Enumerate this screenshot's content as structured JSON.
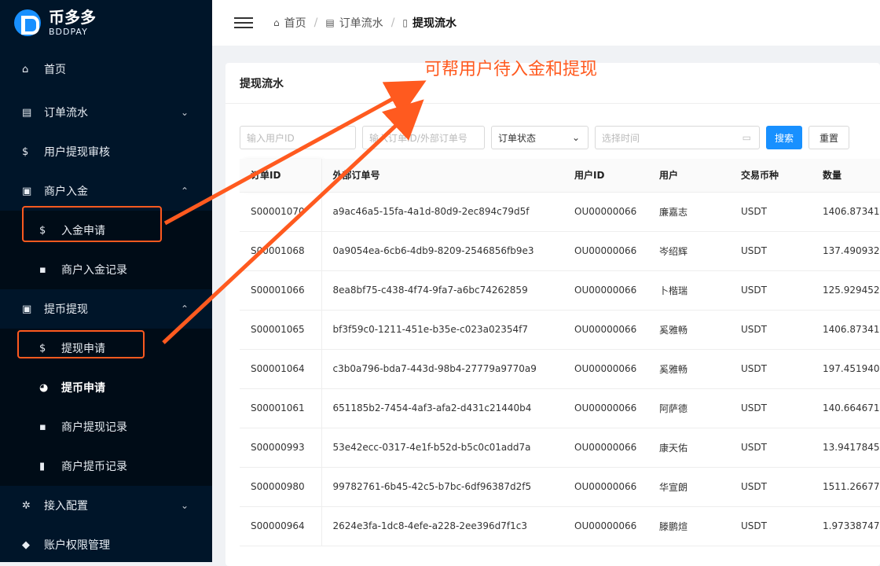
{
  "brand": {
    "name": "币多多",
    "sub": "BDDPAY"
  },
  "sidebar": {
    "items": [
      {
        "label": "首页",
        "icon": "home-icon",
        "glyph": "⌂"
      },
      {
        "label": "订单流水",
        "icon": "book-icon",
        "glyph": "▤",
        "arrow": "⌄"
      },
      {
        "label": "用户提现审核",
        "icon": "dollar-icon",
        "glyph": "$"
      },
      {
        "label": "商户入金",
        "icon": "money-icon",
        "glyph": "▣",
        "arrow": "⌃"
      }
    ],
    "deposit_sub": [
      {
        "label": "入金申请",
        "icon": "dollar-icon",
        "glyph": "$"
      },
      {
        "label": "商户入金记录",
        "icon": "doc-icon",
        "glyph": "▪"
      }
    ],
    "withdraw_group": {
      "label": "提币提现",
      "icon": "money-icon",
      "glyph": "▣",
      "arrow": "⌃"
    },
    "withdraw_sub": [
      {
        "label": "提现申请",
        "icon": "dollar-icon",
        "glyph": "$"
      },
      {
        "label": "提币申请",
        "icon": "pie-icon",
        "glyph": "◕"
      },
      {
        "label": "商户提现记录",
        "icon": "doc-icon",
        "glyph": "▪"
      },
      {
        "label": "商户提币记录",
        "icon": "file-icon",
        "glyph": "▮"
      }
    ],
    "bottom": [
      {
        "label": "接入配置",
        "icon": "gear-icon",
        "glyph": "✲",
        "arrow": "⌄"
      },
      {
        "label": "账户权限管理",
        "icon": "user-icon",
        "glyph": "◆"
      }
    ]
  },
  "header": {
    "breadcrumb": [
      "首页",
      "订单流水",
      "提现流水"
    ]
  },
  "annotation": "可帮用户待入金和提现",
  "card": {
    "title": "提现流水"
  },
  "filters": {
    "user_id_placeholder": "输入用户ID",
    "order_placeholder": "输入订单ID/外部订单号",
    "status_label": "订单状态",
    "time_placeholder": "选择时间",
    "search_label": "搜索",
    "reset_label": "重置"
  },
  "table": {
    "headers": [
      "订单ID",
      "外部订单号",
      "用户ID",
      "用户",
      "交易币种",
      "数量"
    ],
    "rows": [
      [
        "S00001070",
        "a9ac46a5-15fa-4a1d-80d9-2ec894c79d5f",
        "OU00000066",
        "廉嘉志",
        "USDT",
        "1406.87341"
      ],
      [
        "S00001068",
        "0a9054ea-6cb6-4db9-8209-2546856fb9e3",
        "OU00000066",
        "岑绍辉",
        "USDT",
        "137.490932"
      ],
      [
        "S00001066",
        "8ea8bf75-c438-4f74-9fa7-a6bc74262859",
        "OU00000066",
        "卜楷瑞",
        "USDT",
        "125.929452"
      ],
      [
        "S00001065",
        "bf3f59c0-1211-451e-b35e-c023a02354f7",
        "OU00000066",
        "奚雅畅",
        "USDT",
        "1406.87341"
      ],
      [
        "S00001064",
        "c3b0a796-bda7-443d-98b4-27779a9770a9",
        "OU00000066",
        "奚雅畅",
        "USDT",
        "197.451940"
      ],
      [
        "S00001061",
        "651185b2-7454-4af3-afa2-d431c21440b4",
        "OU00000066",
        "阿萨德",
        "USDT",
        "140.664671"
      ],
      [
        "S00000993",
        "53e42ecc-0317-4e1f-b52d-b5c0c01add7a",
        "OU00000066",
        "康天佑",
        "USDT",
        "13.9417845"
      ],
      [
        "S00000980",
        "99782761-6b45-42c5-b7bc-6df96387d2f5",
        "OU00000066",
        "华宣朗",
        "USDT",
        "1511.26677"
      ],
      [
        "S00000964",
        "2624e3fa-1dc8-4efe-a228-2ee396d7f1c3",
        "OU00000066",
        "滕鹏煊",
        "USDT",
        "1.97338747"
      ]
    ]
  },
  "colors": {
    "accent": "#1890ff",
    "annotation": "#ff5a1f",
    "sidebar": "#001529"
  }
}
